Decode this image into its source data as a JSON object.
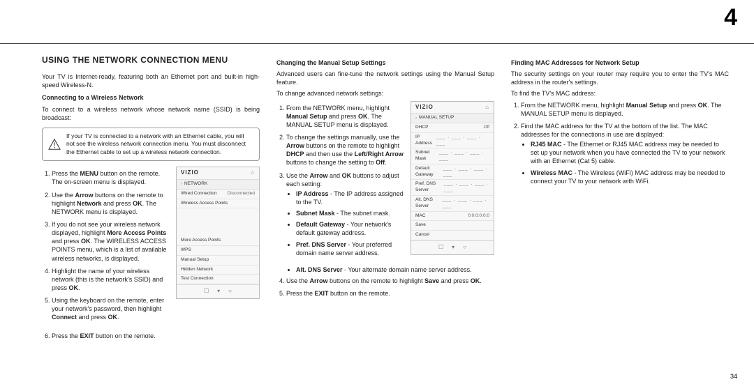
{
  "chapter_number": "4",
  "page_number": "34",
  "section_title": "USING THE NETWORK CONNECTION MENU",
  "col1": {
    "intro": "Your TV is Internet-ready, featuring both an Ethernet port and built-in high-speed Wireless-N.",
    "sub1": "Connecting to a Wireless Network",
    "sub1_intro": "To connect to a wireless network whose network name (SSID) is being broadcast:",
    "warn": "If your TV is connected to a network with an Ethernet cable, you will not see the wireless network connection menu. You must disconnect the Ethernet cable to set up a wireless network connection.",
    "steps_a": {
      "s1a": "Press the ",
      "s1b": "MENU",
      "s1c": " button on the remote. The on-screen menu is displayed.",
      "s2a": "Use the ",
      "s2b": "Arrow",
      "s2c": " buttons on the remote to highlight ",
      "s2d": "Network",
      "s2e": " and press ",
      "s2f": "OK",
      "s2g": ". The NETWORK menu is displayed.",
      "s3a": "If you do not see your wireless network displayed, highlight ",
      "s3b": "More Access Points",
      "s3c": " and press ",
      "s3d": "OK",
      "s3e": ". The WIRELESS ACCESS POINTS menu, which is a list of available wireless networks, is displayed.",
      "s4a": "Highlight the name of your wireless network (this is the network's SSID) and press ",
      "s4b": "OK",
      "s4c": ".",
      "s5a": "Using the keyboard on the remote, enter your network's password, then highlight ",
      "s5b": "Connect",
      "s5c": " and press ",
      "s5d": "OK",
      "s5e": "."
    },
    "step6a": "Press the ",
    "step6b": "EXIT",
    "step6c": " button on the remote."
  },
  "screen_network": {
    "brand": "VIZIO",
    "menu_label": "NETWORK",
    "row1_l": "Wired Connection",
    "row1_r": "Disconnected",
    "row2": "Wireless Access Points",
    "row3": "More Access Points",
    "row4": "WPS",
    "row5": "Manual Setup",
    "row6": "Hidden Network",
    "row7": "Test Connection"
  },
  "col2": {
    "sub": "Changing the Manual Setup Settings",
    "intro": "Advanced users can fine-tune the network settings using the Manual Setup feature.",
    "lead": "To change advanced network settings:",
    "s1a": "From the NETWORK menu, highlight ",
    "s1b": "Manual Setup",
    "s1c": " and press ",
    "s1d": "OK",
    "s1e": ". The MANUAL SETUP menu is displayed.",
    "s2a": "To change the settings manually, use the ",
    "s2b": "Arrow",
    "s2c": " buttons on the remote to highlight ",
    "s2d": "DHCP",
    "s2e": " and then use the ",
    "s2f": "Left/Right Arrow",
    "s2g": " buttons to change the setting to ",
    "s2h": "Off",
    "s2i": ".",
    "s3a": "Use the ",
    "s3b": "Arrow",
    "s3c": " and ",
    "s3d": "OK",
    "s3e": " buttons to adjust each setting:",
    "b_ip_t": "IP Address",
    "b_ip_d": " - The IP address assigned to the TV.",
    "b_sn_t": "Subnet Mask",
    "b_sn_d": " - The subnet mask.",
    "b_dg_t": "Default Gateway",
    "b_dg_d": " - Your network's default gateway address.",
    "b_pd_t": "Pref. DNS Server",
    "b_pd_d": " - Your preferred domain name server address.",
    "b_ad_t": "Alt. DNS Server",
    "b_ad_d": " - Your alternate domain name server address.",
    "s4a": "Use the ",
    "s4b": "Arrow",
    "s4c": " buttons on the remote to highlight ",
    "s4d": "Save",
    "s4e": " and press ",
    "s4f": "OK",
    "s4g": ".",
    "s5a": "Press the ",
    "s5b": "EXIT",
    "s5c": " button on the remote."
  },
  "screen_manual": {
    "brand": "VIZIO",
    "menu_label": "MANUAL SETUP",
    "dhcp_l": "DHCP",
    "dhcp_r": "Off",
    "ip": "IP Address",
    "sn": "Subnet Mask",
    "dg": "Default Gateway",
    "pd": "Pref. DNS Server",
    "ad": "Alt. DNS Server",
    "mac_l": "MAC",
    "mac_r": "0:0:0:0:0:0",
    "save": "Save",
    "cancel": "Cancel",
    "fill": "___ . ___ . ___ . ___"
  },
  "col3": {
    "sub": "Finding MAC Addresses for Network Setup",
    "intro": "The security settings on your router may require you to enter the TV's MAC address in the router's settings.",
    "lead": "To find the TV's MAC address:",
    "s1a": "From the NETWORK menu, highlight ",
    "s1b": "Manual Setup",
    "s1c": " and press ",
    "s1d": "OK",
    "s1e": ". The MANUAL SETUP menu is displayed.",
    "s2": "Find the MAC address for the TV at the bottom of the list. The MAC addresses for the connections in use are displayed:",
    "b_rj_t": "RJ45 MAC",
    "b_rj_d": " - The Ethernet or RJ45 MAC address may be needed to set up your network when you have connected the TV to your network with an Ethernet (Cat 5) cable.",
    "b_wm_t": "Wireless MAC",
    "b_wm_d": " - The Wireless (WiFi) MAC address may be needed to connect your TV to your network with WiFi."
  },
  "icons": {
    "home": "⌂",
    "back": "☐",
    "down": "▾",
    "circle": "○",
    "chev": "‹"
  }
}
